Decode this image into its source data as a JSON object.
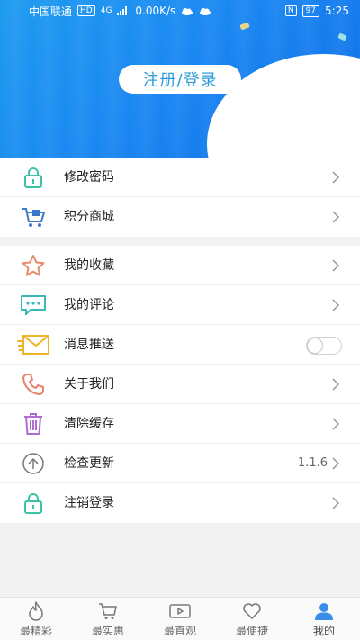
{
  "status_bar": {
    "carrier": "中国联通",
    "hd": "HD",
    "network": "4G",
    "speed": "0.00K/s",
    "battery": "97",
    "time": "5:25"
  },
  "header": {
    "login_button": "注册/登录"
  },
  "menu_group_1": [
    {
      "label": "修改密码",
      "icon": "lock-icon",
      "color": "#3cc2a4"
    },
    {
      "label": "积分商城",
      "icon": "cart-icon",
      "color": "#3a78c9"
    }
  ],
  "menu_group_2": [
    {
      "label": "我的收藏",
      "icon": "star-icon",
      "color": "#e98a6b"
    },
    {
      "label": "我的评论",
      "icon": "comment-icon",
      "color": "#3ab7b8"
    },
    {
      "label": "消息推送",
      "icon": "envelope-icon",
      "color": "#f0b429",
      "toggle": false
    },
    {
      "label": "关于我们",
      "icon": "phone-icon",
      "color": "#e8826a"
    },
    {
      "label": "清除缓存",
      "icon": "trash-icon",
      "color": "#b06ad1"
    },
    {
      "label": "检查更新",
      "icon": "upload-icon",
      "color": "#777777",
      "value": "1.1.6"
    },
    {
      "label": "注销登录",
      "icon": "lock-icon",
      "color": "#3cc2a4"
    }
  ],
  "bottom_nav": [
    {
      "label": "最精彩",
      "icon": "flame-icon"
    },
    {
      "label": "最实惠",
      "icon": "cart-icon"
    },
    {
      "label": "最直观",
      "icon": "video-icon"
    },
    {
      "label": "最便捷",
      "icon": "heart-icon"
    },
    {
      "label": "我的",
      "icon": "user-icon",
      "active": true
    }
  ],
  "colors": {
    "header_blue": "#1a86f2",
    "login_text": "#2e9bd9",
    "active_tab": "#3a8ee6"
  }
}
